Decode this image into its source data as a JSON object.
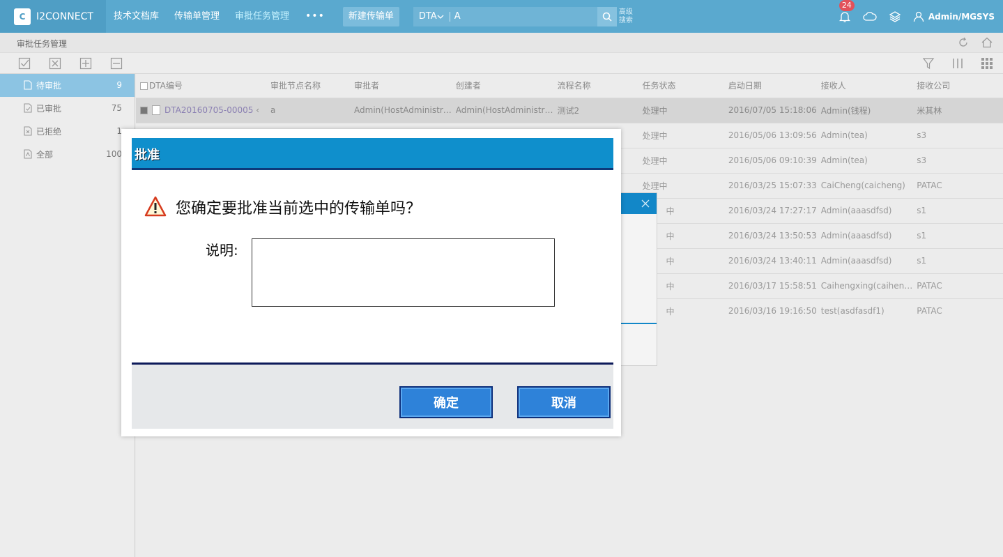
{
  "header": {
    "logo_text": "I2CONNECT",
    "nav": [
      "技术文档库",
      "传输单管理",
      "审批任务管理"
    ],
    "nav_more": "•••",
    "new_button": "新建传输单",
    "search": {
      "type": "DTA",
      "value": "A",
      "advanced": "高级搜索"
    },
    "notification_count": "24",
    "user": "Admin/MGSYS"
  },
  "breadcrumb": "审批任务管理",
  "sidebar": {
    "items": [
      {
        "label": "待审批",
        "count": "9"
      },
      {
        "label": "已审批",
        "count": "75"
      },
      {
        "label": "已拒绝",
        "count": "1"
      },
      {
        "label": "全部",
        "count": "100"
      }
    ]
  },
  "table": {
    "columns": [
      "DTA编号",
      "审批节点名称",
      "审批者",
      "创建者",
      "流程名称",
      "任务状态",
      "启动日期",
      "接收人",
      "接收公司"
    ],
    "rows": [
      {
        "id": "DTA20160705-00005",
        "node": "a",
        "approver": "Admin(HostAdministr…",
        "creator": "Admin(HostAdministr…",
        "flow": "测试2",
        "status": "处理中",
        "date": "2016/07/05 15:18:06",
        "receiver": "Admin(钱程)",
        "company": "米其林"
      },
      {
        "status": "处理中",
        "date": "2016/05/06 13:09:56",
        "receiver": "Admin(tea)",
        "company": "s3"
      },
      {
        "status": "处理中",
        "date": "2016/05/06 09:10:39",
        "receiver": "Admin(tea)",
        "company": "s3"
      },
      {
        "status": "处理中",
        "date": "2016/03/25 15:07:33",
        "receiver": "CaiCheng(caicheng)",
        "company": "PATAC"
      },
      {
        "status": "中",
        "date": "2016/03/24 17:27:17",
        "receiver": "Admin(aaasdfsd)",
        "company": "s1"
      },
      {
        "status": "中",
        "date": "2016/03/24 13:50:53",
        "receiver": "Admin(aaasdfsd)",
        "company": "s1"
      },
      {
        "status": "中",
        "date": "2016/03/24 13:40:11",
        "receiver": "Admin(aaasdfsd)",
        "company": "s1"
      },
      {
        "status": "中",
        "date": "2016/03/17 15:58:51",
        "receiver": "Caihengxing(caihen…",
        "company": "PATAC"
      },
      {
        "status": "中",
        "date": "2016/03/16 19:16:50",
        "receiver": "test(asdfasdf1)",
        "company": "PATAC"
      }
    ]
  },
  "dialog": {
    "title": "批准",
    "question": "您确定要批准当前选中的传输单吗？",
    "note_label": "说明:",
    "note_value": "",
    "ok": "确定",
    "cancel": "取消"
  },
  "colors": {
    "header": "#5aa9cf",
    "dialog_header": "#0f8fcc",
    "button": "#2e82d9",
    "sidebar_active": "#8cc4e3"
  }
}
